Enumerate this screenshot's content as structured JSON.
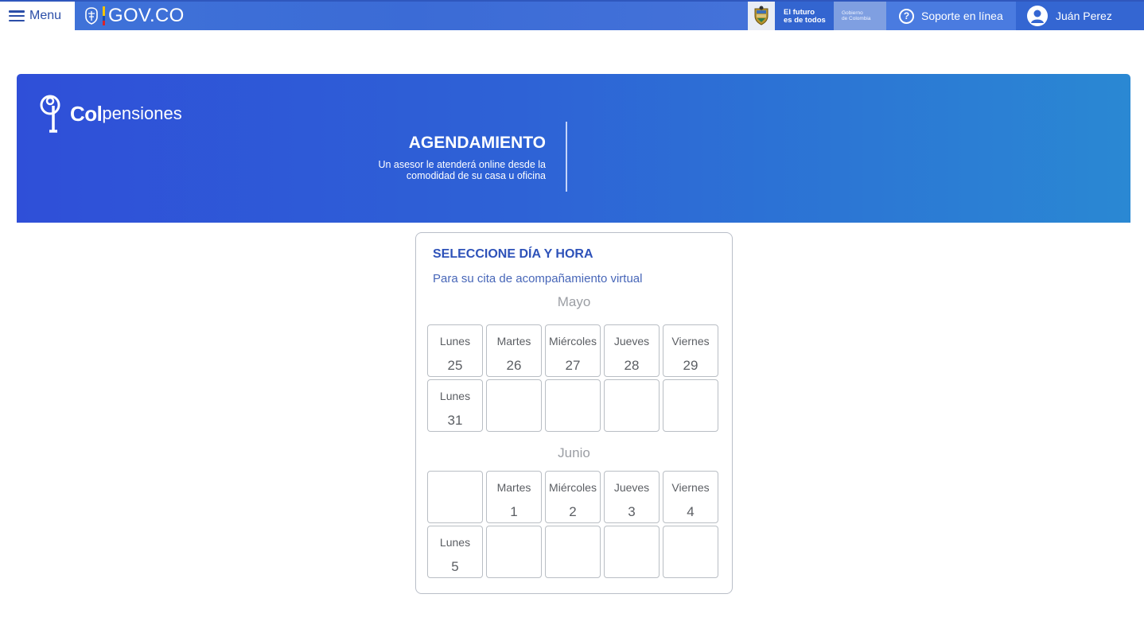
{
  "topbar": {
    "menu_label": "Menu",
    "brand": "GOV.CO",
    "futuro_line1": "El futuro",
    "futuro_line2": "es de todos",
    "gobierno_line1": "Gobierno",
    "gobierno_line2": "de Colombia",
    "support_label": "Soporte en línea",
    "user_name": "Juán Perez"
  },
  "banner": {
    "logo_bold": "Col",
    "logo_rest": "pensiones",
    "title": "AGENDAMIENTO",
    "subtitle_line1": "Un asesor le atenderá online desde la",
    "subtitle_line2": "comodidad de su casa u oficina"
  },
  "card": {
    "title": "SELECCIONE DÍA Y HORA",
    "subtitle": "Para su cita de acompañamiento virtual",
    "months": [
      {
        "name": "Mayo",
        "cells": [
          {
            "day": "Lunes",
            "date": "25"
          },
          {
            "day": "Martes",
            "date": "26"
          },
          {
            "day": "Miércoles",
            "date": "27"
          },
          {
            "day": "Jueves",
            "date": "28"
          },
          {
            "day": "Viernes",
            "date": "29"
          },
          {
            "day": "Lunes",
            "date": "31"
          },
          {
            "day": "",
            "date": ""
          },
          {
            "day": "",
            "date": ""
          },
          {
            "day": "",
            "date": ""
          },
          {
            "day": "",
            "date": ""
          }
        ]
      },
      {
        "name": "Junio",
        "cells": [
          {
            "day": "",
            "date": ""
          },
          {
            "day": "Martes",
            "date": "1"
          },
          {
            "day": "Miércoles",
            "date": "2"
          },
          {
            "day": "Jueves",
            "date": "3"
          },
          {
            "day": "Viernes",
            "date": "4"
          },
          {
            "day": "Lunes",
            "date": "5"
          },
          {
            "day": "",
            "date": ""
          },
          {
            "day": "",
            "date": ""
          },
          {
            "day": "",
            "date": ""
          },
          {
            "day": "",
            "date": ""
          }
        ]
      }
    ]
  },
  "colors": {
    "topbar_blue": "#3a67d4",
    "banner_start": "#2f4fd8",
    "banner_end": "#2a88d3",
    "card_title": "#2e52b9"
  }
}
